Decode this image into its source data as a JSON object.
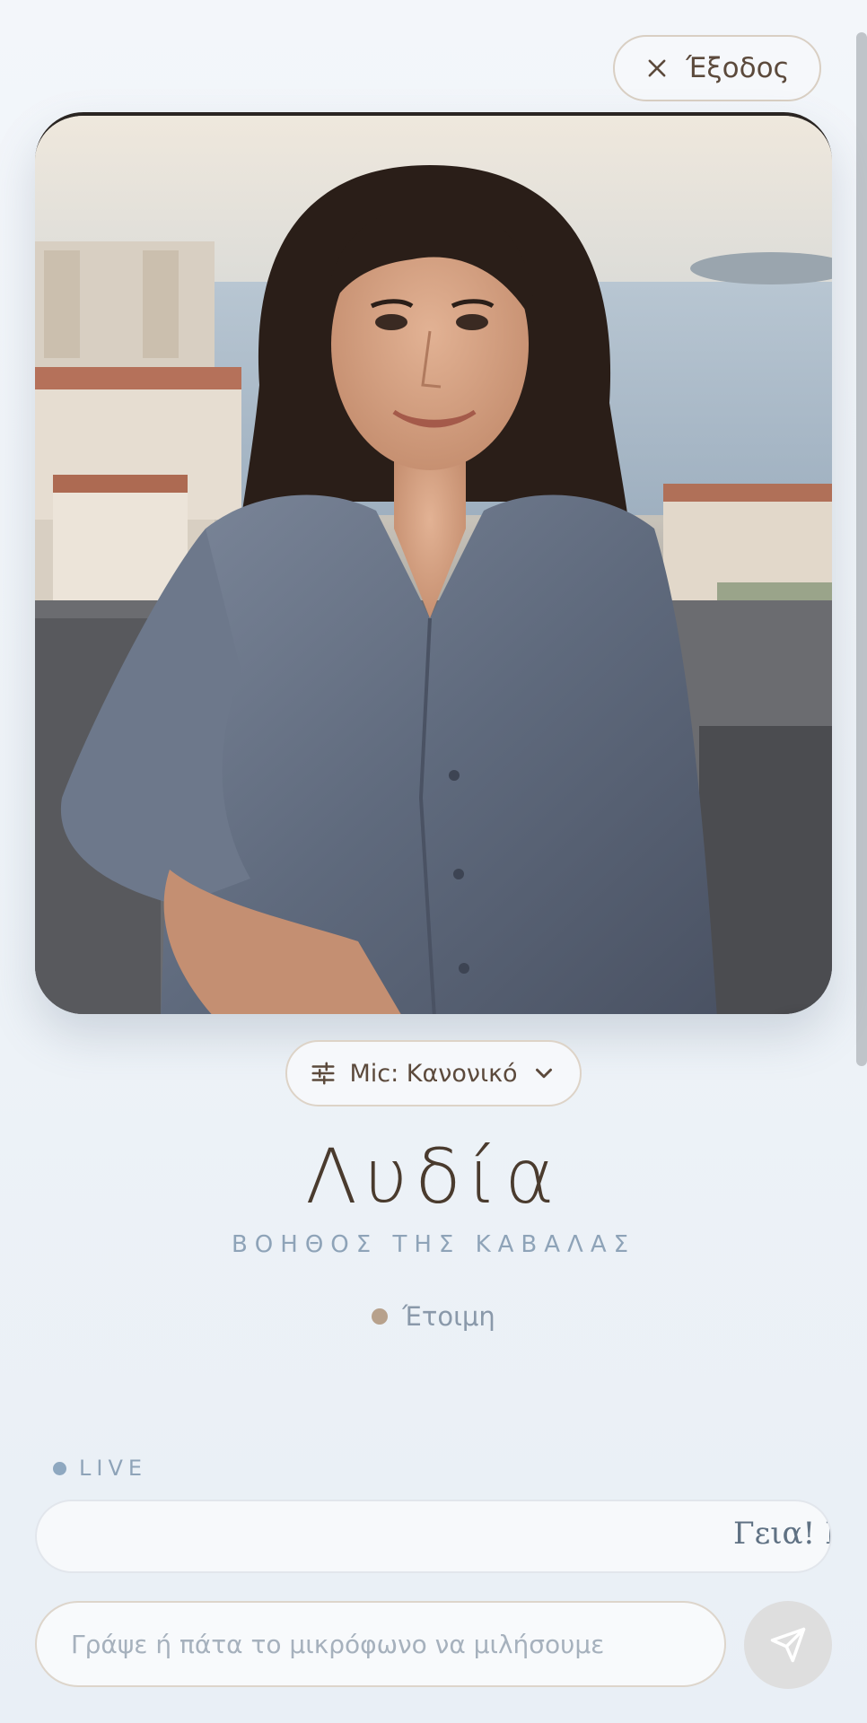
{
  "header": {
    "exit_label": "Έξοδος"
  },
  "controls": {
    "mic_mode_label": "Mic: Κανονικό"
  },
  "assistant": {
    "name": "Λυδία",
    "role": "ΒΟΗΘΟΣ ΤΗΣ ΚΑΒΑΛΑΣ",
    "status": "Έτοιμη"
  },
  "live": {
    "label": "LIVE",
    "ticker_text": "Γεια! Ε"
  },
  "composer": {
    "placeholder": "Γράψε ή πάτα το μικρόφωνο να μιλήσουμε"
  },
  "icons": {
    "exit": "close-icon",
    "mic": "microphone-icon",
    "mic_settings": "sliders-icon",
    "dropdown": "chevron-down-icon",
    "send": "send-icon"
  },
  "colors": {
    "accent": "#b5a08b",
    "text_primary": "#4a3b2e",
    "text_muted": "#8ea3b8",
    "status_dot": "#b7a18c"
  }
}
